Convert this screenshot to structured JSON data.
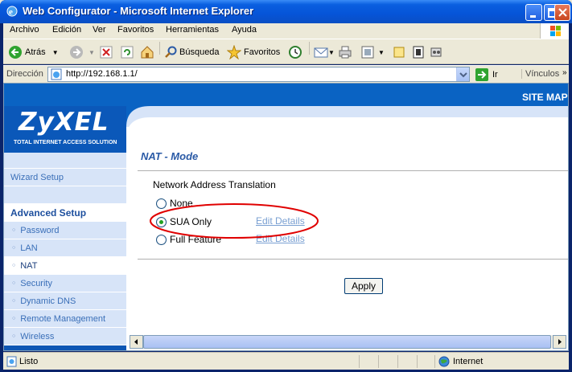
{
  "window": {
    "title": "Web Configurator - Microsoft Internet Explorer"
  },
  "menu": {
    "items": [
      "Archivo",
      "Edición",
      "Ver",
      "Favoritos",
      "Herramientas",
      "Ayuda"
    ]
  },
  "toolbar": {
    "back_label": "Atrás",
    "search_label": "Búsqueda",
    "favorites_label": "Favoritos"
  },
  "address": {
    "label": "Dirección",
    "url": "http://192.168.1.1/",
    "go_label": "Ir",
    "links_label": "Vínculos"
  },
  "brand": {
    "logo": "ZyXEL",
    "tagline": "Total Internet Access Solution",
    "sitemap": "SITE MAP"
  },
  "nav": {
    "wizard": "Wizard Setup",
    "advanced": "Advanced Setup",
    "items": [
      "Password",
      "LAN",
      "NAT",
      "Security",
      "Dynamic DNS",
      "Remote Management",
      "Wireless"
    ],
    "active": "NAT"
  },
  "content": {
    "title": "NAT - Mode",
    "section_label": "Network Address Translation",
    "options": [
      {
        "label": "None",
        "checked": false
      },
      {
        "label": "SUA Only",
        "checked": true,
        "link": "Edit Details"
      },
      {
        "label": "Full Feature",
        "checked": false,
        "link": "Edit Details"
      }
    ],
    "apply_label": "Apply",
    "highlight_color": "#e00000"
  },
  "status": {
    "text": "Listo",
    "zone": "Internet"
  }
}
